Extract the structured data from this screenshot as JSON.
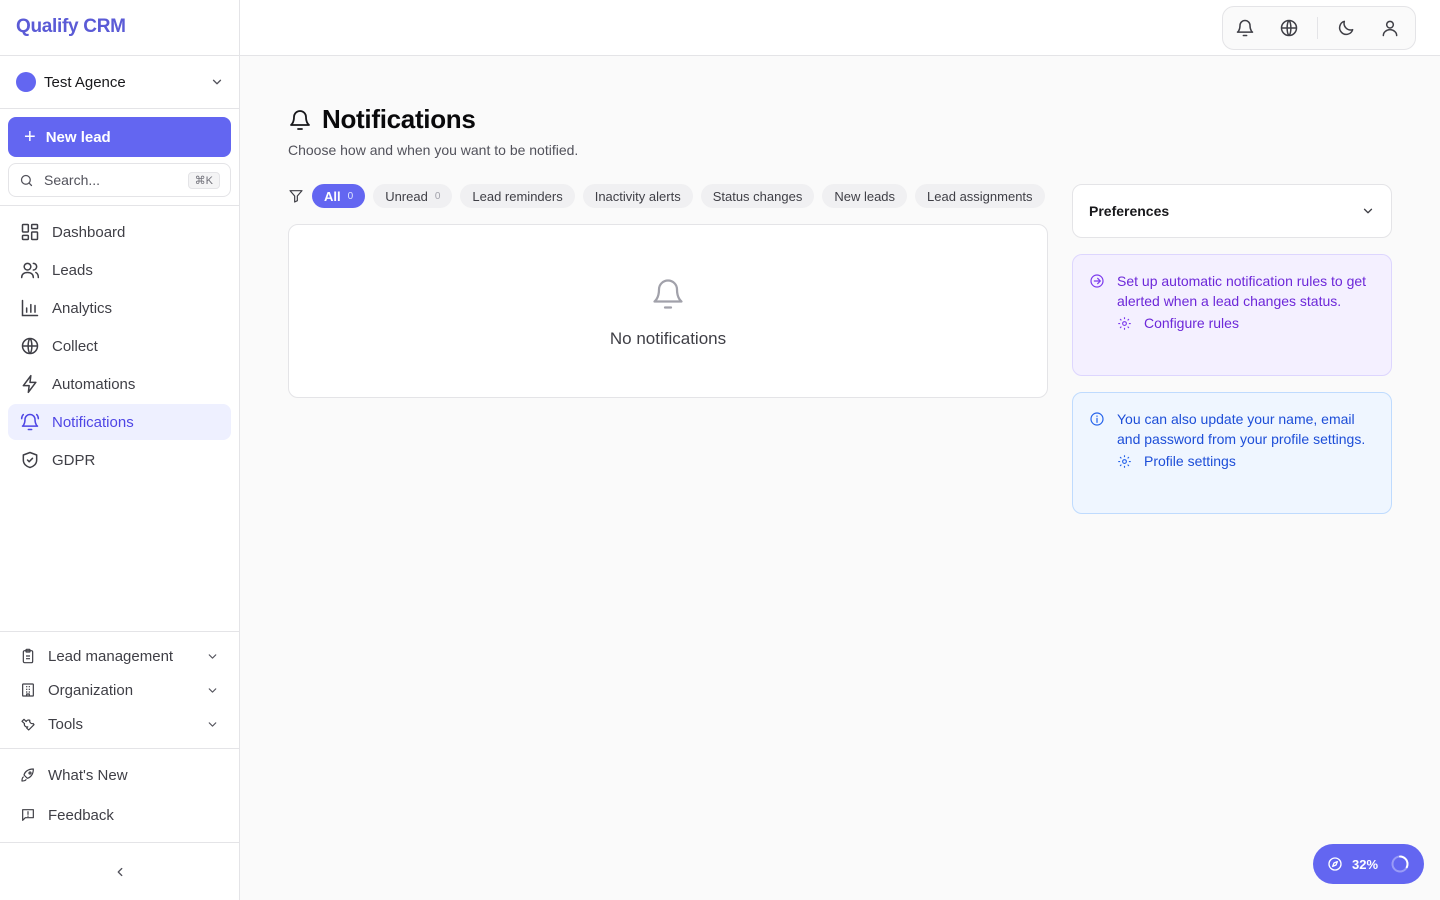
{
  "app": {
    "brand": "Qualify CRM"
  },
  "workspace": {
    "name": "Test Agence"
  },
  "sidebar": {
    "new_lead_label": "New lead",
    "search_placeholder": "Search...",
    "search_shortcut": "⌘K",
    "nav": [
      {
        "label": "Dashboard",
        "icon": "dashboard-icon"
      },
      {
        "label": "Leads",
        "icon": "users-icon"
      },
      {
        "label": "Analytics",
        "icon": "bar-chart-icon"
      },
      {
        "label": "Collect",
        "icon": "globe-icon"
      },
      {
        "label": "Automations",
        "icon": "lightning-icon"
      },
      {
        "label": "Notifications",
        "icon": "bell-ring-icon",
        "active": true
      },
      {
        "label": "GDPR",
        "icon": "shield-check-icon"
      }
    ],
    "groups": [
      {
        "label": "Lead management",
        "icon": "clipboard-icon"
      },
      {
        "label": "Organization",
        "icon": "building-icon"
      },
      {
        "label": "Tools",
        "icon": "wrench-icon"
      }
    ],
    "footer": [
      {
        "label": "What's New",
        "icon": "rocket-icon"
      },
      {
        "label": "Feedback",
        "icon": "message-square-icon"
      }
    ]
  },
  "topbar": {
    "icons": [
      "bell-icon",
      "globe-icon",
      "moon-icon",
      "user-icon"
    ]
  },
  "page": {
    "title": "Notifications",
    "subtitle": "Choose how and when you want to be notified."
  },
  "filters": [
    {
      "label": "All",
      "count": "0",
      "active": true
    },
    {
      "label": "Unread",
      "count": "0"
    },
    {
      "label": "Lead reminders"
    },
    {
      "label": "Inactivity alerts"
    },
    {
      "label": "Status changes"
    },
    {
      "label": "New leads"
    },
    {
      "label": "Lead assignments"
    }
  ],
  "empty_state": {
    "text": "No notifications"
  },
  "preferences": {
    "label": "Preferences"
  },
  "info_cards": {
    "rules": {
      "text": "Set up automatic notification rules to get alerted when a lead changes status.",
      "link": "Configure rules"
    },
    "profile": {
      "text": "You can also update your name, email and password from your profile settings.",
      "link": "Profile settings"
    }
  },
  "progress": {
    "percent": "32%"
  },
  "colors": {
    "accent": "#6366f1",
    "accent_text": "#4f46e5"
  }
}
